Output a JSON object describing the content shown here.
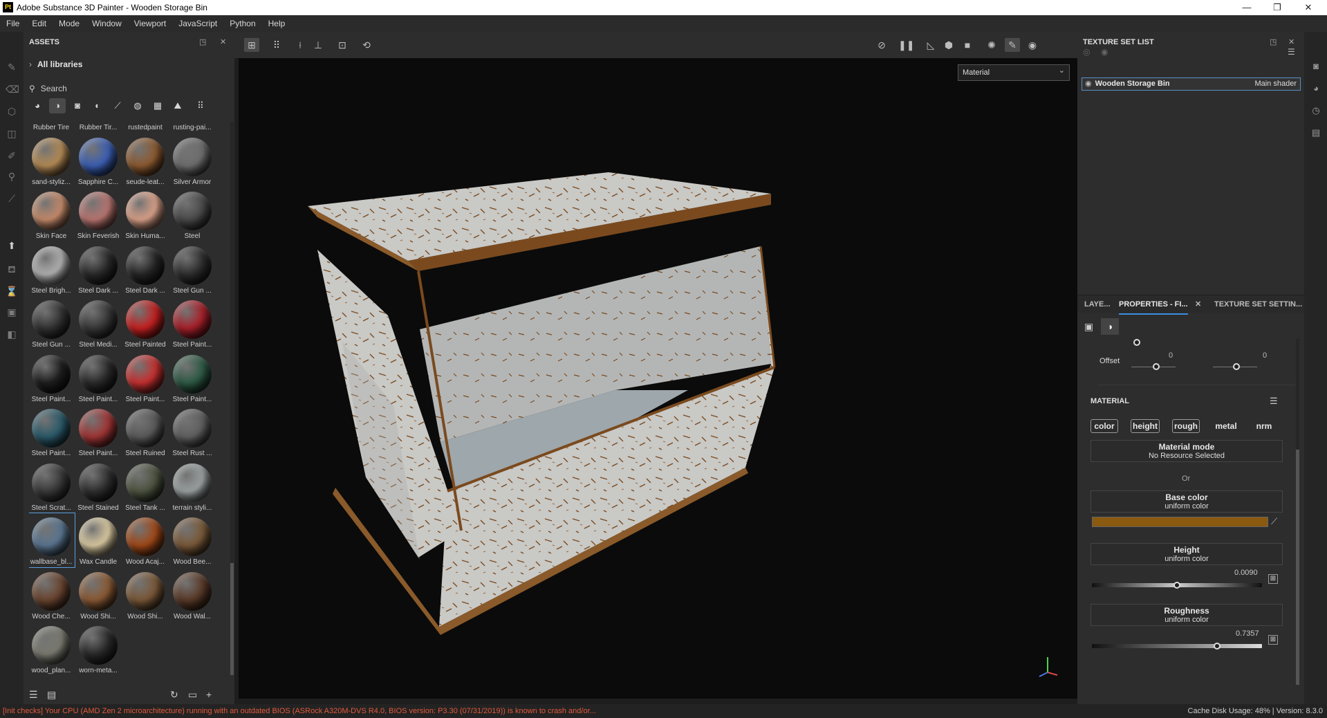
{
  "window": {
    "title": "Adobe Substance 3D Painter - Wooden Storage Bin",
    "app_icon": "Pt"
  },
  "menu": [
    "File",
    "Edit",
    "Mode",
    "Window",
    "Viewport",
    "JavaScript",
    "Python",
    "Help"
  ],
  "assets": {
    "title": "ASSETS",
    "breadcrumb": "All libraries",
    "search_placeholder": "Search",
    "items": [
      {
        "label": "Rubber Tire",
        "color": "#2a2a2a"
      },
      {
        "label": "Rubber Tir...",
        "color": "#262626"
      },
      {
        "label": "rustedpaint",
        "color": "#6a4a30"
      },
      {
        "label": "rusting-pai...",
        "color": "#7a5a40"
      },
      {
        "label": "sand-styliz...",
        "color": "#b38a55"
      },
      {
        "label": "Sapphire C...",
        "color": "#3b5fb3"
      },
      {
        "label": "seude-leat...",
        "color": "#8c5a30"
      },
      {
        "label": "Silver Armor",
        "color": "#6e6e6e"
      },
      {
        "label": "Skin Face",
        "color": "#c48a6a"
      },
      {
        "label": "Skin Feverish",
        "color": "#b87570"
      },
      {
        "label": "Skin Huma...",
        "color": "#d8a088"
      },
      {
        "label": "Steel",
        "color": "#4a4a4a"
      },
      {
        "label": "Steel Brigh...",
        "color": "#b0b0b0"
      },
      {
        "label": "Steel Dark ...",
        "color": "#2a2a2a"
      },
      {
        "label": "Steel Dark ...",
        "color": "#262626"
      },
      {
        "label": "Steel Gun ...",
        "color": "#2e2e2e"
      },
      {
        "label": "Steel Gun ...",
        "color": "#333333"
      },
      {
        "label": "Steel Medi...",
        "color": "#383838"
      },
      {
        "label": "Steel Painted",
        "color": "#c42020"
      },
      {
        "label": "Steel Paint...",
        "color": "#a8202a"
      },
      {
        "label": "Steel Paint...",
        "color": "#1e1e1e"
      },
      {
        "label": "Steel Paint...",
        "color": "#2a2a2a"
      },
      {
        "label": "Steel Paint...",
        "color": "#c63030"
      },
      {
        "label": "Steel Paint...",
        "color": "#2e5a45"
      },
      {
        "label": "Steel Paint...",
        "color": "#2b5a6a"
      },
      {
        "label": "Steel Paint...",
        "color": "#a03535"
      },
      {
        "label": "Steel Ruined",
        "color": "#5a5a5a"
      },
      {
        "label": "Steel Rust ...",
        "color": "#606060"
      },
      {
        "label": "Steel Scrat...",
        "color": "#3a3a3a"
      },
      {
        "label": "Steel Stained",
        "color": "#2f2f2f"
      },
      {
        "label": "Steel Tank ...",
        "color": "#4d5440"
      },
      {
        "label": "terrain styli...",
        "color": "#9aa0a0"
      },
      {
        "label": "wallbase_bl...",
        "color": "#5a7590"
      },
      {
        "label": "Wax Candle",
        "color": "#d8c8a0"
      },
      {
        "label": "Wood Acaj...",
        "color": "#a04818"
      },
      {
        "label": "Wood Bee...",
        "color": "#7a5a3a"
      },
      {
        "label": "Wood Che...",
        "color": "#6a4530"
      },
      {
        "label": "Wood Shi...",
        "color": "#8a5a35"
      },
      {
        "label": "Wood Shi...",
        "color": "#7a5838"
      },
      {
        "label": "Wood Wal...",
        "color": "#5a3a28"
      },
      {
        "label": "wood_plan...",
        "color": "#7a7a70"
      },
      {
        "label": "worn-meta...",
        "color": "#2a2a2a"
      }
    ]
  },
  "viewport": {
    "display_mode": "Material"
  },
  "texture_set_list": {
    "title": "TEXTURE SET LIST",
    "item_name": "Wooden Storage Bin",
    "item_shader": "Main shader"
  },
  "tabs": {
    "layers": "LAYE...",
    "properties": "PROPERTIES - FI...",
    "texture_settings": "TEXTURE SET SETTIN..."
  },
  "properties": {
    "offset_label": "Offset",
    "offset_u": "0",
    "offset_v": "0",
    "material_header": "MATERIAL",
    "chips": [
      "color",
      "height",
      "rough",
      "metal",
      "nrm"
    ],
    "material_mode_title": "Material mode",
    "material_mode_value": "No Resource Selected",
    "or_text": "Or",
    "base_color_title": "Base color",
    "base_color_sub": "uniform color",
    "base_color_hex": "#8a5a10",
    "height_title": "Height",
    "height_sub": "uniform color",
    "height_value": "0.0090",
    "height_level": 0.5,
    "roughness_title": "Roughness",
    "roughness_sub": "uniform color",
    "roughness_value": "0.7357",
    "roughness_level": 0.7357
  },
  "status": {
    "error": "[Init checks] Your CPU (AMD Zen 2 microarchitecture) running with an outdated BIOS (ASRock A320M-DVS R4.0, BIOS version: P3.30 (07/31/2019)) is known to crash and/or...",
    "right": "Cache Disk Usage:    48% | Version: 8.3.0"
  }
}
